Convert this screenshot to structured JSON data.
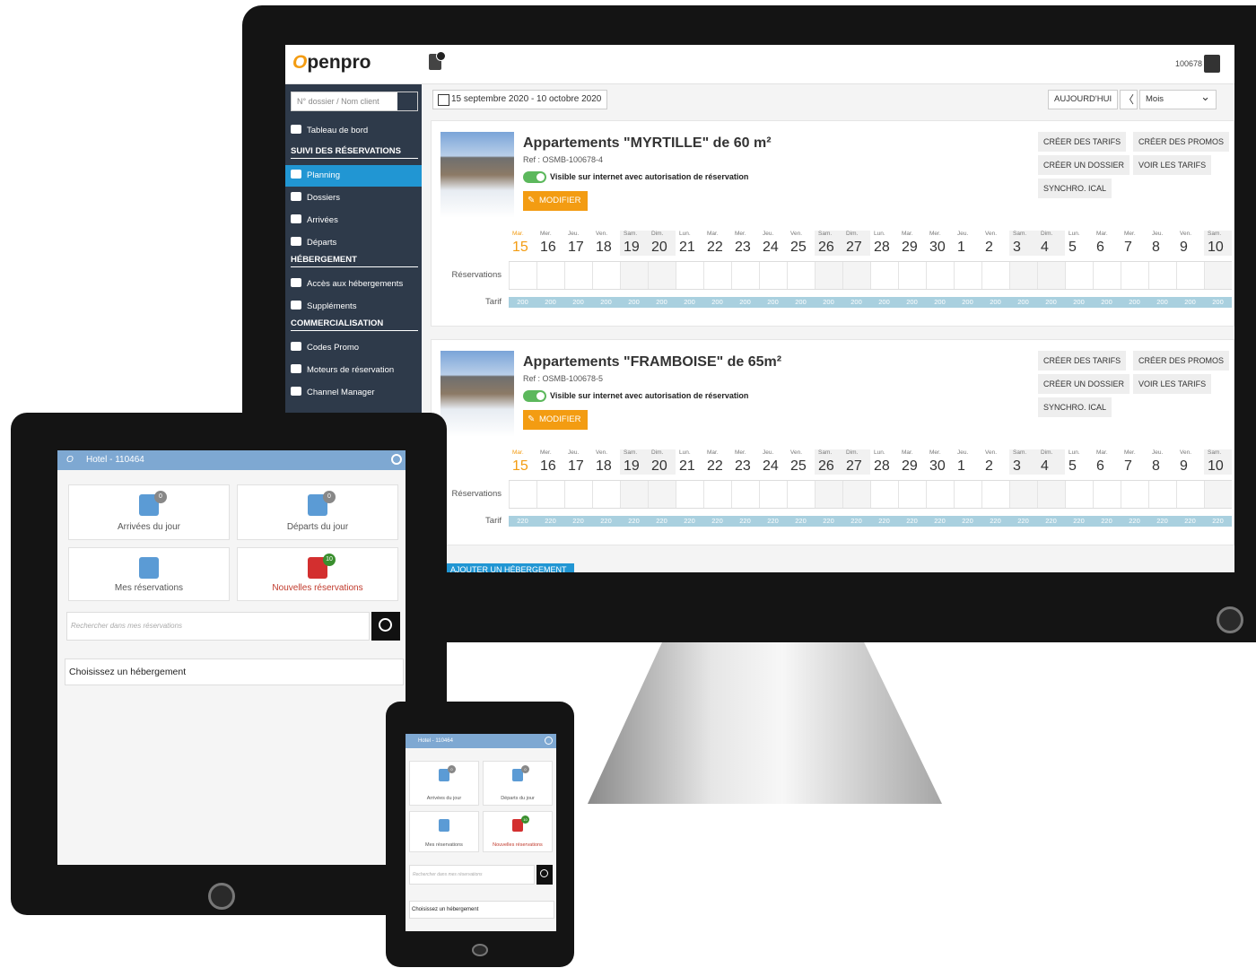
{
  "desktop": {
    "logo_o": "O",
    "logo_text": "penpro",
    "notif_count": "0",
    "user_id": "100678",
    "search_placeholder": "N° dossier / Nom client",
    "sidebar": {
      "dashboard": "Tableau de bord",
      "section_reservations": "SUIVI DES RÉSERVATIONS",
      "planning": "Planning",
      "dossiers": "Dossiers",
      "arrivees": "Arrivées",
      "departs": "Départs",
      "section_hebergement": "HÉBERGEMENT",
      "acces": "Accès aux hébergements",
      "supplements": "Suppléments",
      "section_commercialisation": "COMMERCIALISATION",
      "promo": "Codes Promo",
      "moteurs": "Moteurs de réservation",
      "channel": "Channel Manager"
    },
    "toolbar": {
      "date_range": "15 septembre 2020 - 10 octobre 2020",
      "today": "AUJOURD'HUI",
      "prev": "〈",
      "view": "Mois"
    },
    "actions": {
      "create_tarifs": "CRÉER DES TARIFS",
      "create_promos": "CRÉER DES PROMOS",
      "create_dossier": "CRÉER UN DOSSIER",
      "voir_tarifs": "VOIR LES TARIFS",
      "synchro": "SYNCHRO. ICAL",
      "modifier": "MODIFIER"
    },
    "visible_label": "Visible sur internet avec autorisation de réservation",
    "row_reservations": "Réservations",
    "row_tarif": "Tarif",
    "add_button": "AJOUTER UN HÉBERGEMENT",
    "cards": [
      {
        "title": "Appartements \"MYRTILLE\" de 60 m²",
        "ref": "Ref : OSMB-100678-4",
        "tarif": "200"
      },
      {
        "title": "Appartements \"FRAMBOISE\" de 65m²",
        "ref": "Ref : OSMB-100678-5",
        "tarif": "220"
      }
    ],
    "calendar": {
      "day_names": [
        "Mar.",
        "Mer.",
        "Jeu.",
        "Ven.",
        "Sam.",
        "Dim.",
        "Lun.",
        "Mar.",
        "Mer.",
        "Jeu.",
        "Ven.",
        "Sam.",
        "Dim.",
        "Lun.",
        "Mar.",
        "Mer.",
        "Jeu.",
        "Ven.",
        "Sam.",
        "Dim.",
        "Lun.",
        "Mar.",
        "Mer.",
        "Jeu.",
        "Ven.",
        "Sam."
      ],
      "day_numbers": [
        "15",
        "16",
        "17",
        "18",
        "19",
        "20",
        "21",
        "22",
        "23",
        "24",
        "25",
        "26",
        "27",
        "28",
        "29",
        "30",
        "1",
        "2",
        "3",
        "4",
        "5",
        "6",
        "7",
        "8",
        "9",
        "10"
      ]
    }
  },
  "tablet": {
    "header": "Hotel - 110464",
    "logo": "O",
    "arrivees": "Arrivées du jour",
    "arrivees_count": "0",
    "departs": "Départs du jour",
    "departs_count": "0",
    "mes_reservations": "Mes réservations",
    "nouvelles": "Nouvelles réservations",
    "nouvelles_count": "10",
    "search_placeholder": "Rechercher dans mes réservations",
    "select": "Choisissez un hébergement"
  },
  "phone": {
    "header": "Hotel - 110464",
    "arrivees": "Arrivées du jour",
    "arrivees_count": "0",
    "departs": "Départs du jour",
    "departs_count": "0",
    "mes_reservations": "Mes réservations",
    "nouvelles": "Nouvelles réservations",
    "nouvelles_count": "10",
    "search_placeholder": "Rechercher dans mes réservations",
    "select": "Choisissez un hébergement"
  },
  "colors": {
    "accent_orange": "#f39c12",
    "sidebar_bg": "#2e3a4a",
    "active_blue": "#2196d3",
    "tarif_bar": "#a9d0df",
    "toggle_green": "#5cb85c",
    "alert_red": "#c0392b"
  }
}
